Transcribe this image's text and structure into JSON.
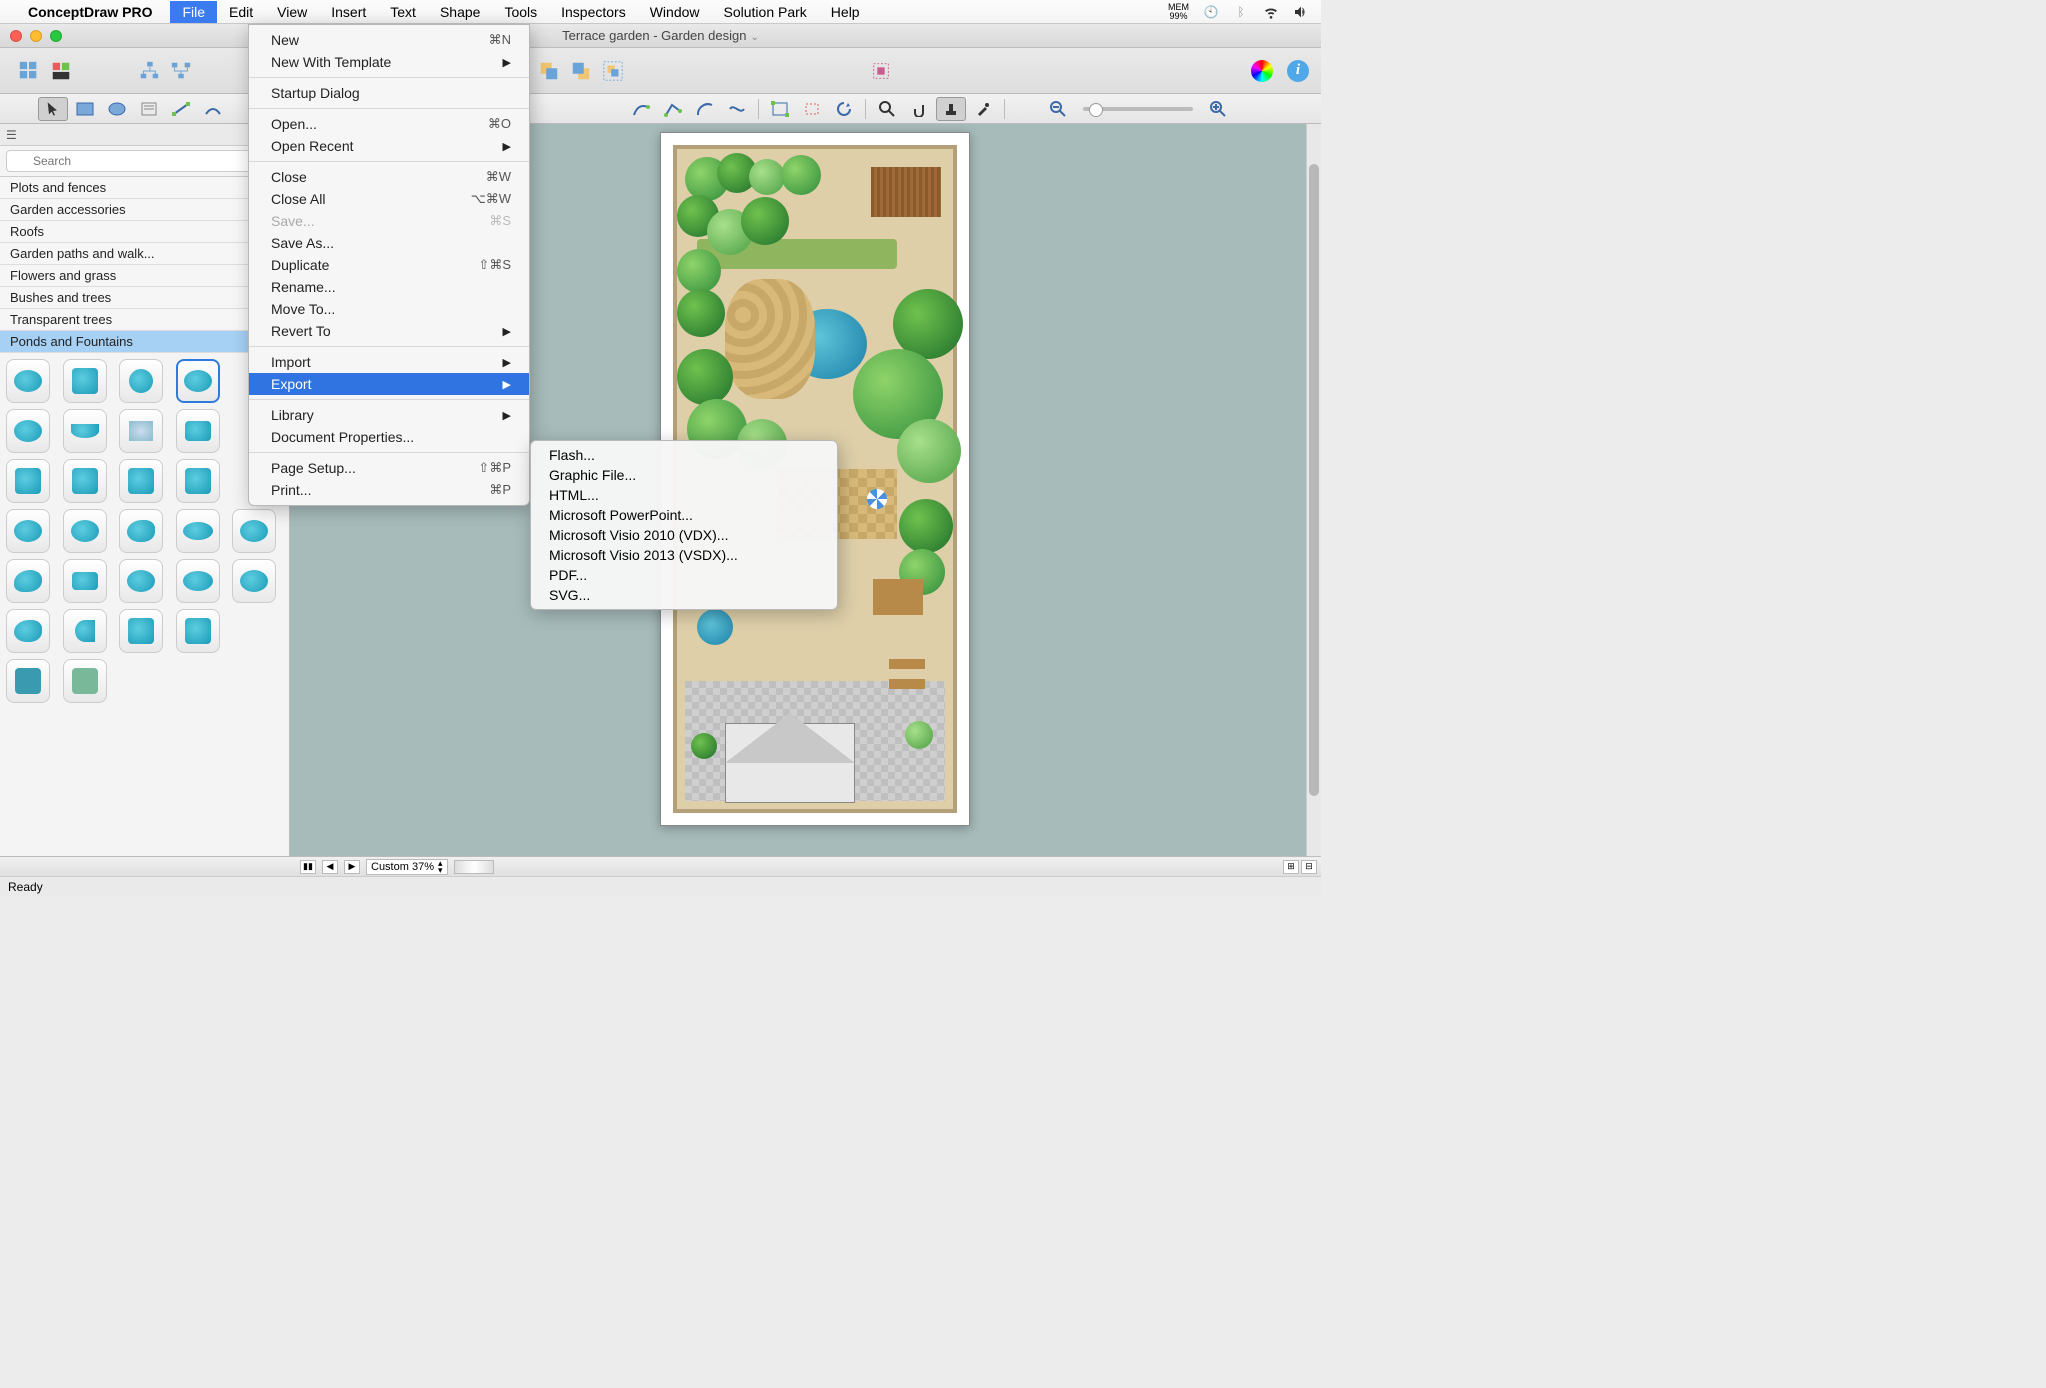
{
  "menubar": {
    "app": "ConceptDraw PRO",
    "items": [
      "File",
      "Edit",
      "View",
      "Insert",
      "Text",
      "Shape",
      "Tools",
      "Inspectors",
      "Window",
      "Solution Park",
      "Help"
    ],
    "activeIndex": 0,
    "mem_label": "MEM",
    "mem_value": "99%"
  },
  "document": {
    "title": "Terrace garden - Garden design"
  },
  "file_menu": {
    "items": [
      {
        "label": "New",
        "shortcut": "⌘N"
      },
      {
        "label": "New With Template",
        "submenu": true
      },
      {
        "sep": true
      },
      {
        "label": "Startup Dialog"
      },
      {
        "sep": true
      },
      {
        "label": "Open...",
        "shortcut": "⌘O"
      },
      {
        "label": "Open Recent",
        "submenu": true
      },
      {
        "sep": true
      },
      {
        "label": "Close",
        "shortcut": "⌘W"
      },
      {
        "label": "Close All",
        "shortcut": "⌥⌘W"
      },
      {
        "label": "Save...",
        "shortcut": "⌘S",
        "disabled": true
      },
      {
        "label": "Save As..."
      },
      {
        "label": "Duplicate",
        "shortcut": "⇧⌘S"
      },
      {
        "label": "Rename..."
      },
      {
        "label": "Move To..."
      },
      {
        "label": "Revert To",
        "submenu": true
      },
      {
        "sep": true
      },
      {
        "label": "Import",
        "submenu": true
      },
      {
        "label": "Export",
        "submenu": true,
        "highlight": true
      },
      {
        "sep": true
      },
      {
        "label": "Library",
        "submenu": true
      },
      {
        "label": "Document Properties..."
      },
      {
        "sep": true
      },
      {
        "label": "Page Setup...",
        "shortcut": "⇧⌘P"
      },
      {
        "label": "Print...",
        "shortcut": "⌘P"
      }
    ]
  },
  "export_submenu": {
    "items": [
      "Flash...",
      "Graphic File...",
      "HTML...",
      "Microsoft PowerPoint...",
      "Microsoft Visio 2010 (VDX)...",
      "Microsoft Visio 2013 (VSDX)...",
      "PDF...",
      "SVG..."
    ]
  },
  "sidebar": {
    "search_placeholder": "Search",
    "categories": [
      "Plots and fences",
      "Garden accessories",
      "Roofs",
      "Garden paths and walk...",
      "Flowers and grass",
      "Bushes and trees",
      "Transparent trees",
      "Ponds and Fountains"
    ],
    "selectedCategoryIndex": 7
  },
  "bottom": {
    "zoom_label": "Custom 37%"
  },
  "status": {
    "text": "Ready"
  }
}
